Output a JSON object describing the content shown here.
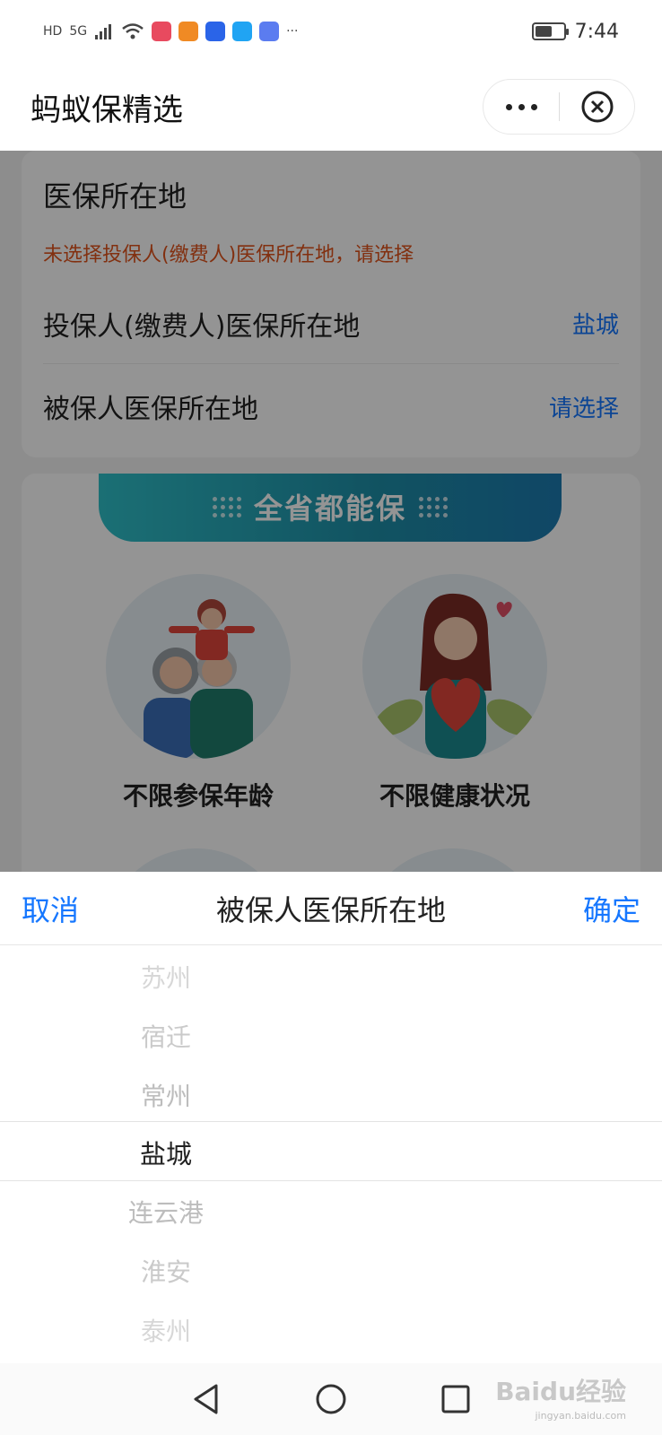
{
  "status_bar": {
    "left_text_hd": "HD",
    "left_text_5g": "5G",
    "more": "···",
    "time": "7:44",
    "battery_level": 0.6
  },
  "header": {
    "title": "蚂蚁保精选"
  },
  "medical_insurance_card": {
    "section_title": "医保所在地",
    "warning": "未选择投保人(缴费人)医保所在地，请选择",
    "rows": [
      {
        "label": "投保人(缴费人)医保所在地",
        "value": "盐城"
      },
      {
        "label": "被保人医保所在地",
        "value": "请选择"
      }
    ]
  },
  "features": {
    "banner": "全省都能保",
    "items": [
      {
        "label": "不限参保年龄"
      },
      {
        "label": "不限健康状况"
      }
    ]
  },
  "picker": {
    "cancel_label": "取消",
    "title": "被保人医保所在地",
    "confirm_label": "确定",
    "options": [
      "苏州",
      "宿迁",
      "常州",
      "盐城",
      "连云港",
      "淮安",
      "泰州"
    ],
    "selected": "盐城"
  },
  "watermark": {
    "text": "Baidu经验",
    "sub": "jingyan.baidu.com"
  },
  "colors": {
    "accent": "#1677ff",
    "warning": "#e0541d",
    "banner": "#1e8fa8"
  }
}
